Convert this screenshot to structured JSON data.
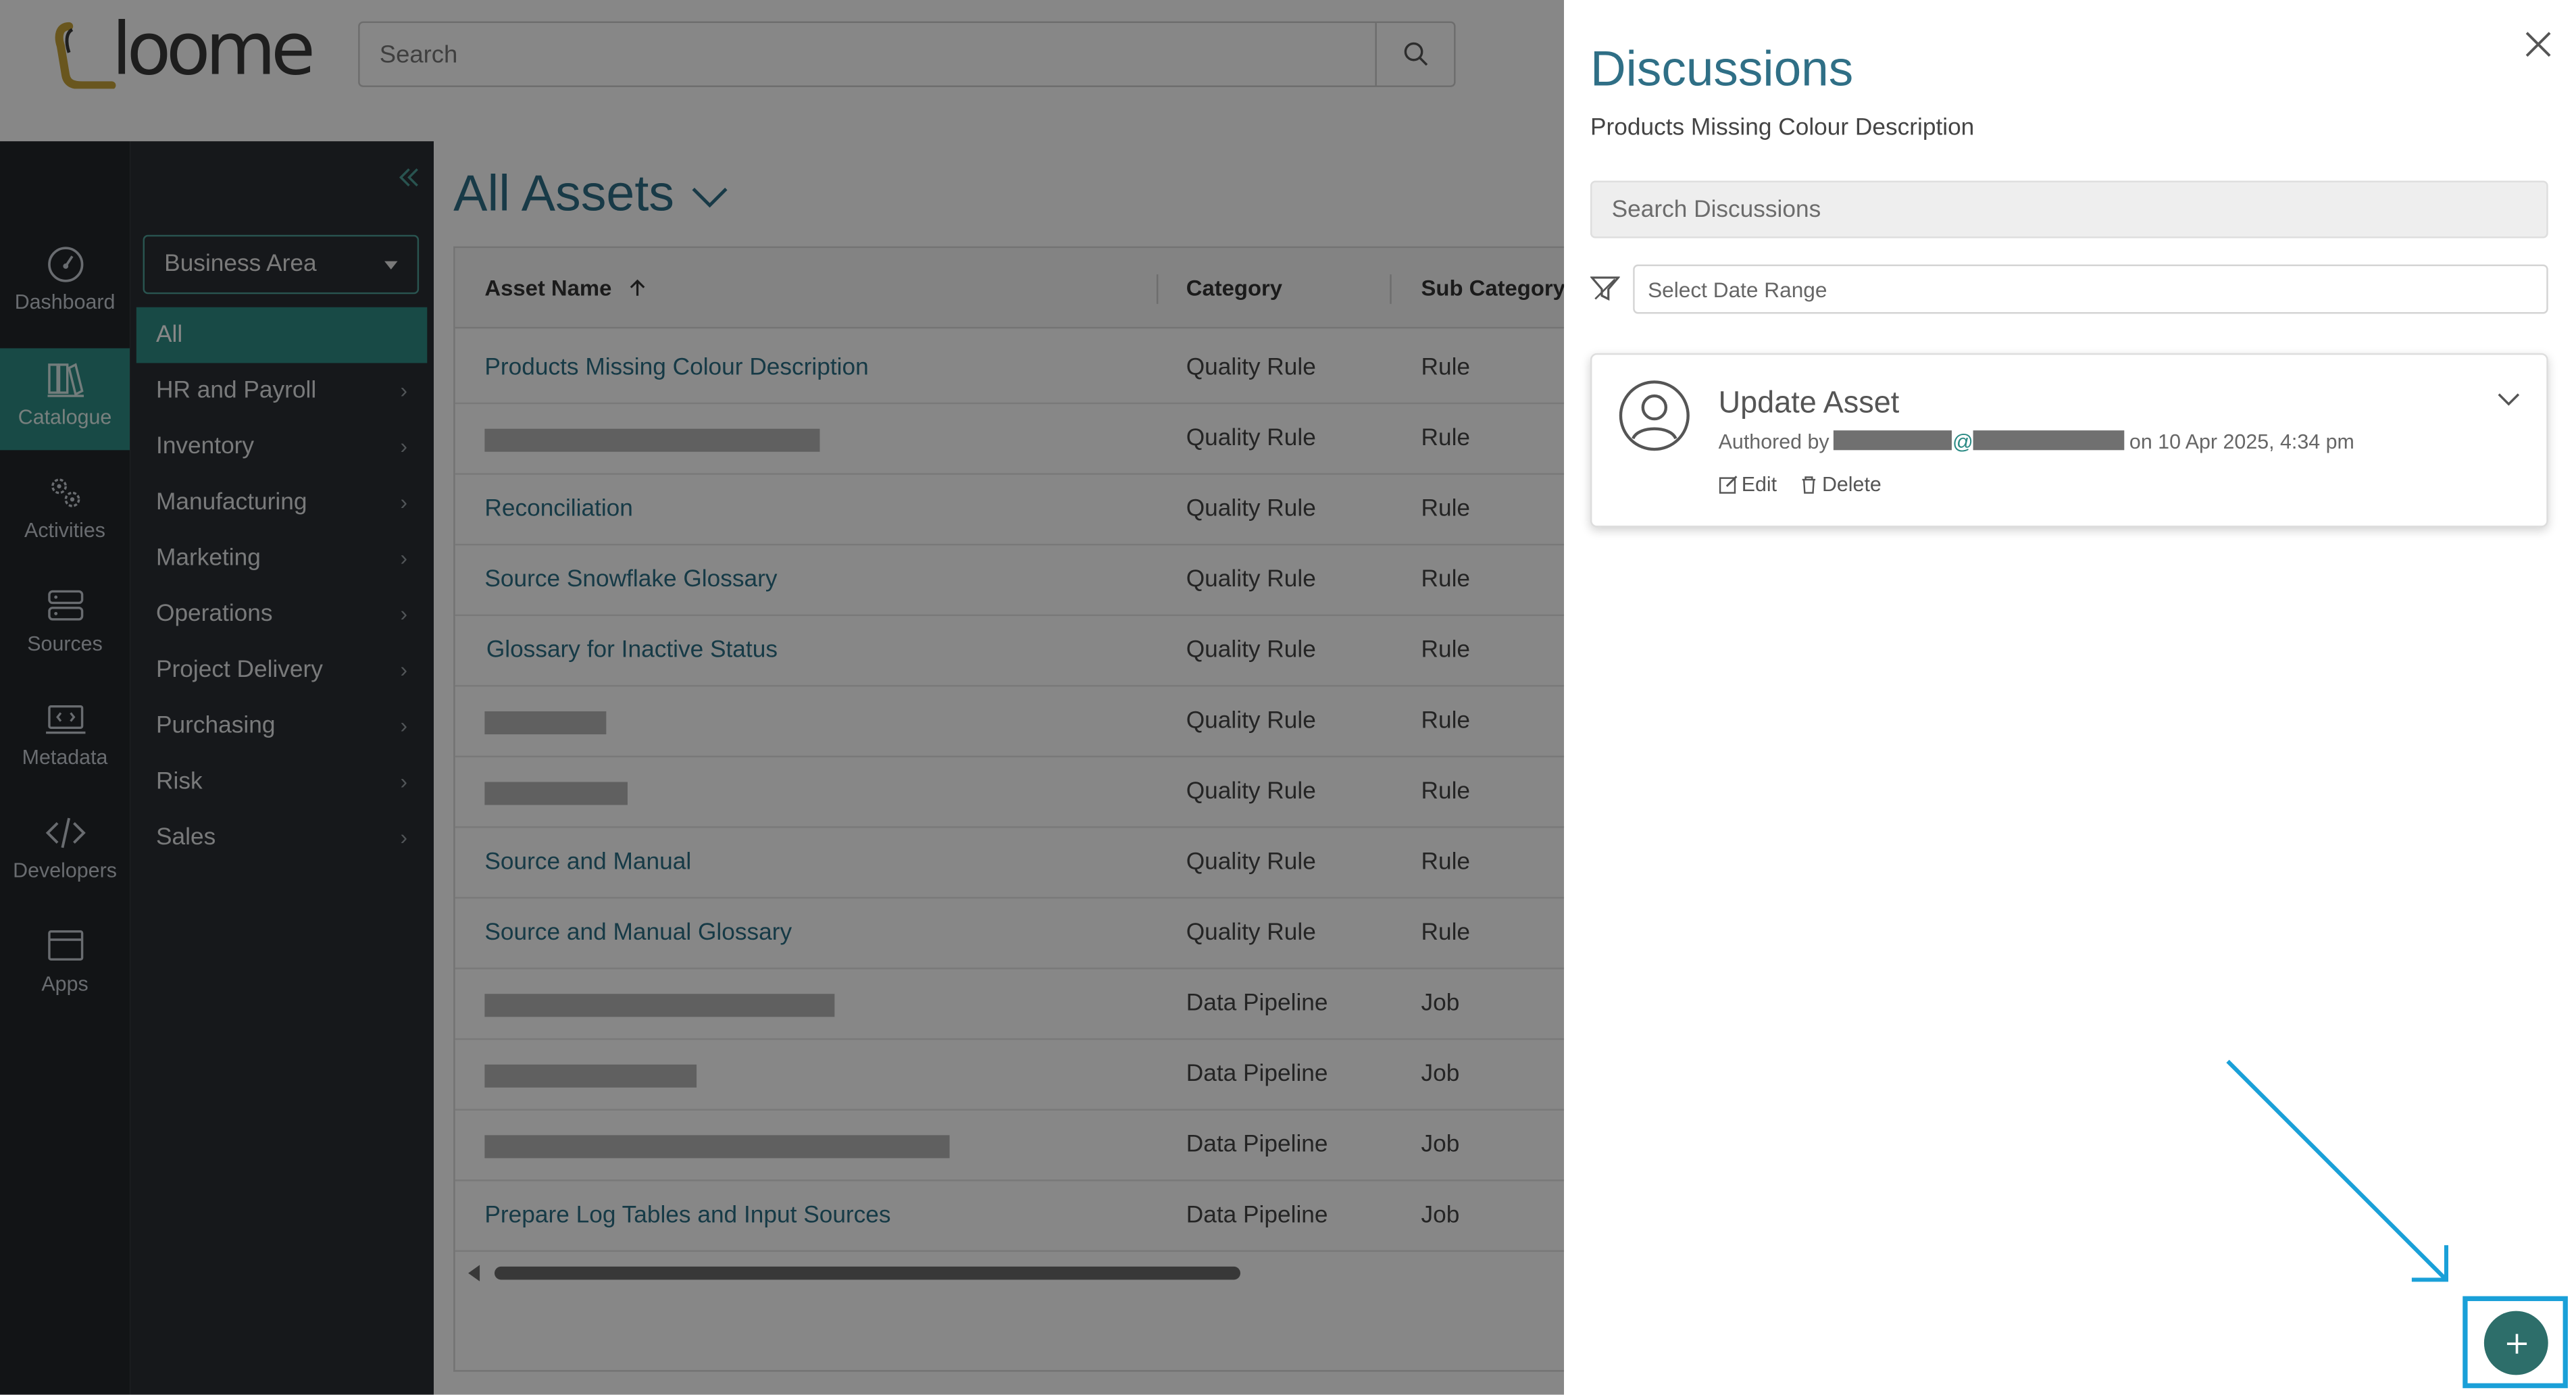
{
  "app": {
    "logo_text": "loome"
  },
  "header": {
    "search_placeholder": "Search"
  },
  "rail": [
    {
      "label": "Dashboard",
      "icon": "dashboard-icon"
    },
    {
      "label": "Catalogue",
      "icon": "catalogue-icon",
      "active": true
    },
    {
      "label": "Activities",
      "icon": "activities-icon"
    },
    {
      "label": "Sources",
      "icon": "sources-icon"
    },
    {
      "label": "Metadata",
      "icon": "metadata-icon"
    },
    {
      "label": "Developers",
      "icon": "developers-icon"
    },
    {
      "label": "Apps",
      "icon": "apps-icon"
    }
  ],
  "sidebar": {
    "business_area": "Business Area",
    "items": [
      {
        "label": "All",
        "active": true
      },
      {
        "label": "HR and Payroll"
      },
      {
        "label": "Inventory"
      },
      {
        "label": "Manufacturing"
      },
      {
        "label": "Marketing"
      },
      {
        "label": "Operations"
      },
      {
        "label": "Project Delivery"
      },
      {
        "label": "Purchasing"
      },
      {
        "label": "Risk"
      },
      {
        "label": "Sales"
      }
    ]
  },
  "main": {
    "title": "All Assets",
    "columns": {
      "name": "Asset Name",
      "category": "Category",
      "sub_category": "Sub Category"
    },
    "rows": [
      {
        "name": "Products Missing Colour Description",
        "category": "Quality Rule",
        "sub": "Rule"
      },
      {
        "name": "",
        "category": "Quality Rule",
        "sub": "Rule"
      },
      {
        "name": "Reconciliation",
        "category": "Quality Rule",
        "sub": "Rule"
      },
      {
        "name": "Source Snowflake Glossary",
        "category": "Quality Rule",
        "sub": "Rule"
      },
      {
        "name": "Glossary for Inactive Status",
        "category": "Quality Rule",
        "sub": "Rule"
      },
      {
        "name": "",
        "category": "Quality Rule",
        "sub": "Rule"
      },
      {
        "name": "",
        "category": "Quality Rule",
        "sub": "Rule"
      },
      {
        "name": "Source and Manual",
        "category": "Quality Rule",
        "sub": "Rule"
      },
      {
        "name": "Source and Manual Glossary",
        "category": "Quality Rule",
        "sub": "Rule"
      },
      {
        "name": "",
        "category": "Data Pipeline",
        "sub": "Job"
      },
      {
        "name": "",
        "category": "Data Pipeline",
        "sub": "Job"
      },
      {
        "name": "",
        "category": "Data Pipeline",
        "sub": "Job"
      },
      {
        "name": "Prepare Log Tables and Input Sources",
        "category": "Data Pipeline",
        "sub": "Job"
      }
    ]
  },
  "panel": {
    "title": "Discussions",
    "subtitle": "Products Missing Colour Description",
    "search_placeholder": "Search Discussions",
    "date_placeholder": "Select Date Range",
    "discussion": {
      "title": "Update Asset",
      "authored_by": "Authored by",
      "at_sign": "@",
      "date": "on 10 Apr 2025, 4:34 pm",
      "edit": "Edit",
      "delete": "Delete"
    }
  },
  "colors": {
    "accent": "#2f8c84",
    "title": "#2f6f86",
    "annotation": "#1aa0d8",
    "fab": "#2d6e6a"
  }
}
